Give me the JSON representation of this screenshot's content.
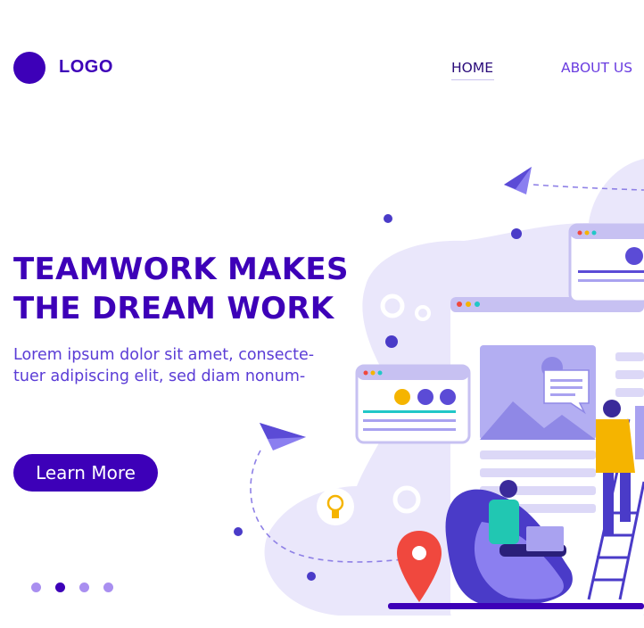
{
  "header": {
    "logo_text": "LOGO",
    "nav": {
      "home": "HOME",
      "about": "ABOUT US"
    }
  },
  "hero": {
    "headline_line1": "TEAMWORK MAKES",
    "headline_line2": "THE DREAM WORK",
    "body_line1": "Lorem ipsum dolor sit amet, consecte-",
    "body_line2": "tuer adipiscing elit, sed diam nonum-",
    "cta_label": "Learn More"
  },
  "pagination": {
    "total": 4,
    "active_index": 1
  },
  "colors": {
    "brand": "#3d00b8",
    "accent": "#6a3de0",
    "illustration_light": "#eae7fb",
    "illustration_mid": "#a9a2f0",
    "pin": "#f0483e",
    "highlight": "#f5b400"
  },
  "illustration": {
    "icons": [
      "paper-plane-icon",
      "gear-icon",
      "lightbulb-icon",
      "location-pin-icon",
      "browser-window-icon",
      "image-placeholder-icon",
      "chat-bubble-icon",
      "ladder-icon",
      "laptop-icon"
    ],
    "figures": [
      "person-with-laptop",
      "person-on-ladder"
    ]
  }
}
